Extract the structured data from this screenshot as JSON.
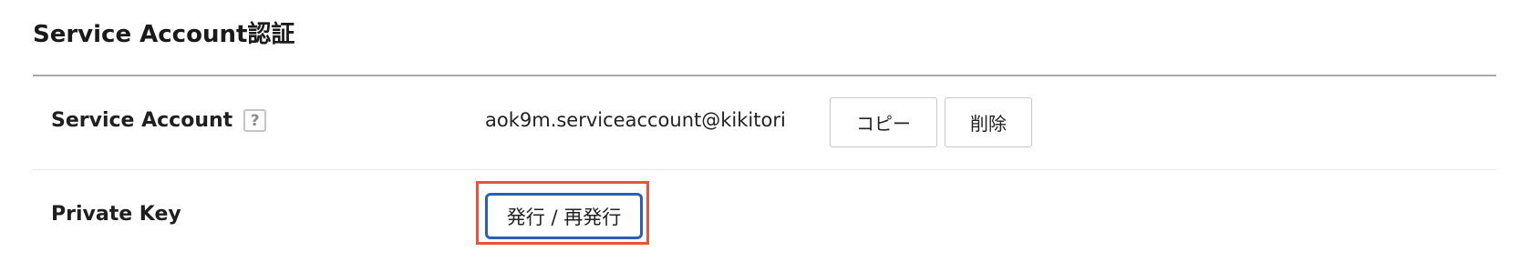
{
  "section": {
    "title": "Service Account認証"
  },
  "service_account": {
    "label": "Service Account",
    "help_icon": "?",
    "value": "aok9m.serviceaccount@kikitori",
    "copy_label": "コピー",
    "delete_label": "削除"
  },
  "private_key": {
    "label": "Private Key",
    "issue_label": "発行 / 再発行"
  },
  "colors": {
    "highlight": "#e8543a",
    "focus_border": "#2a5fb8",
    "divider": "#a8a8a8"
  }
}
